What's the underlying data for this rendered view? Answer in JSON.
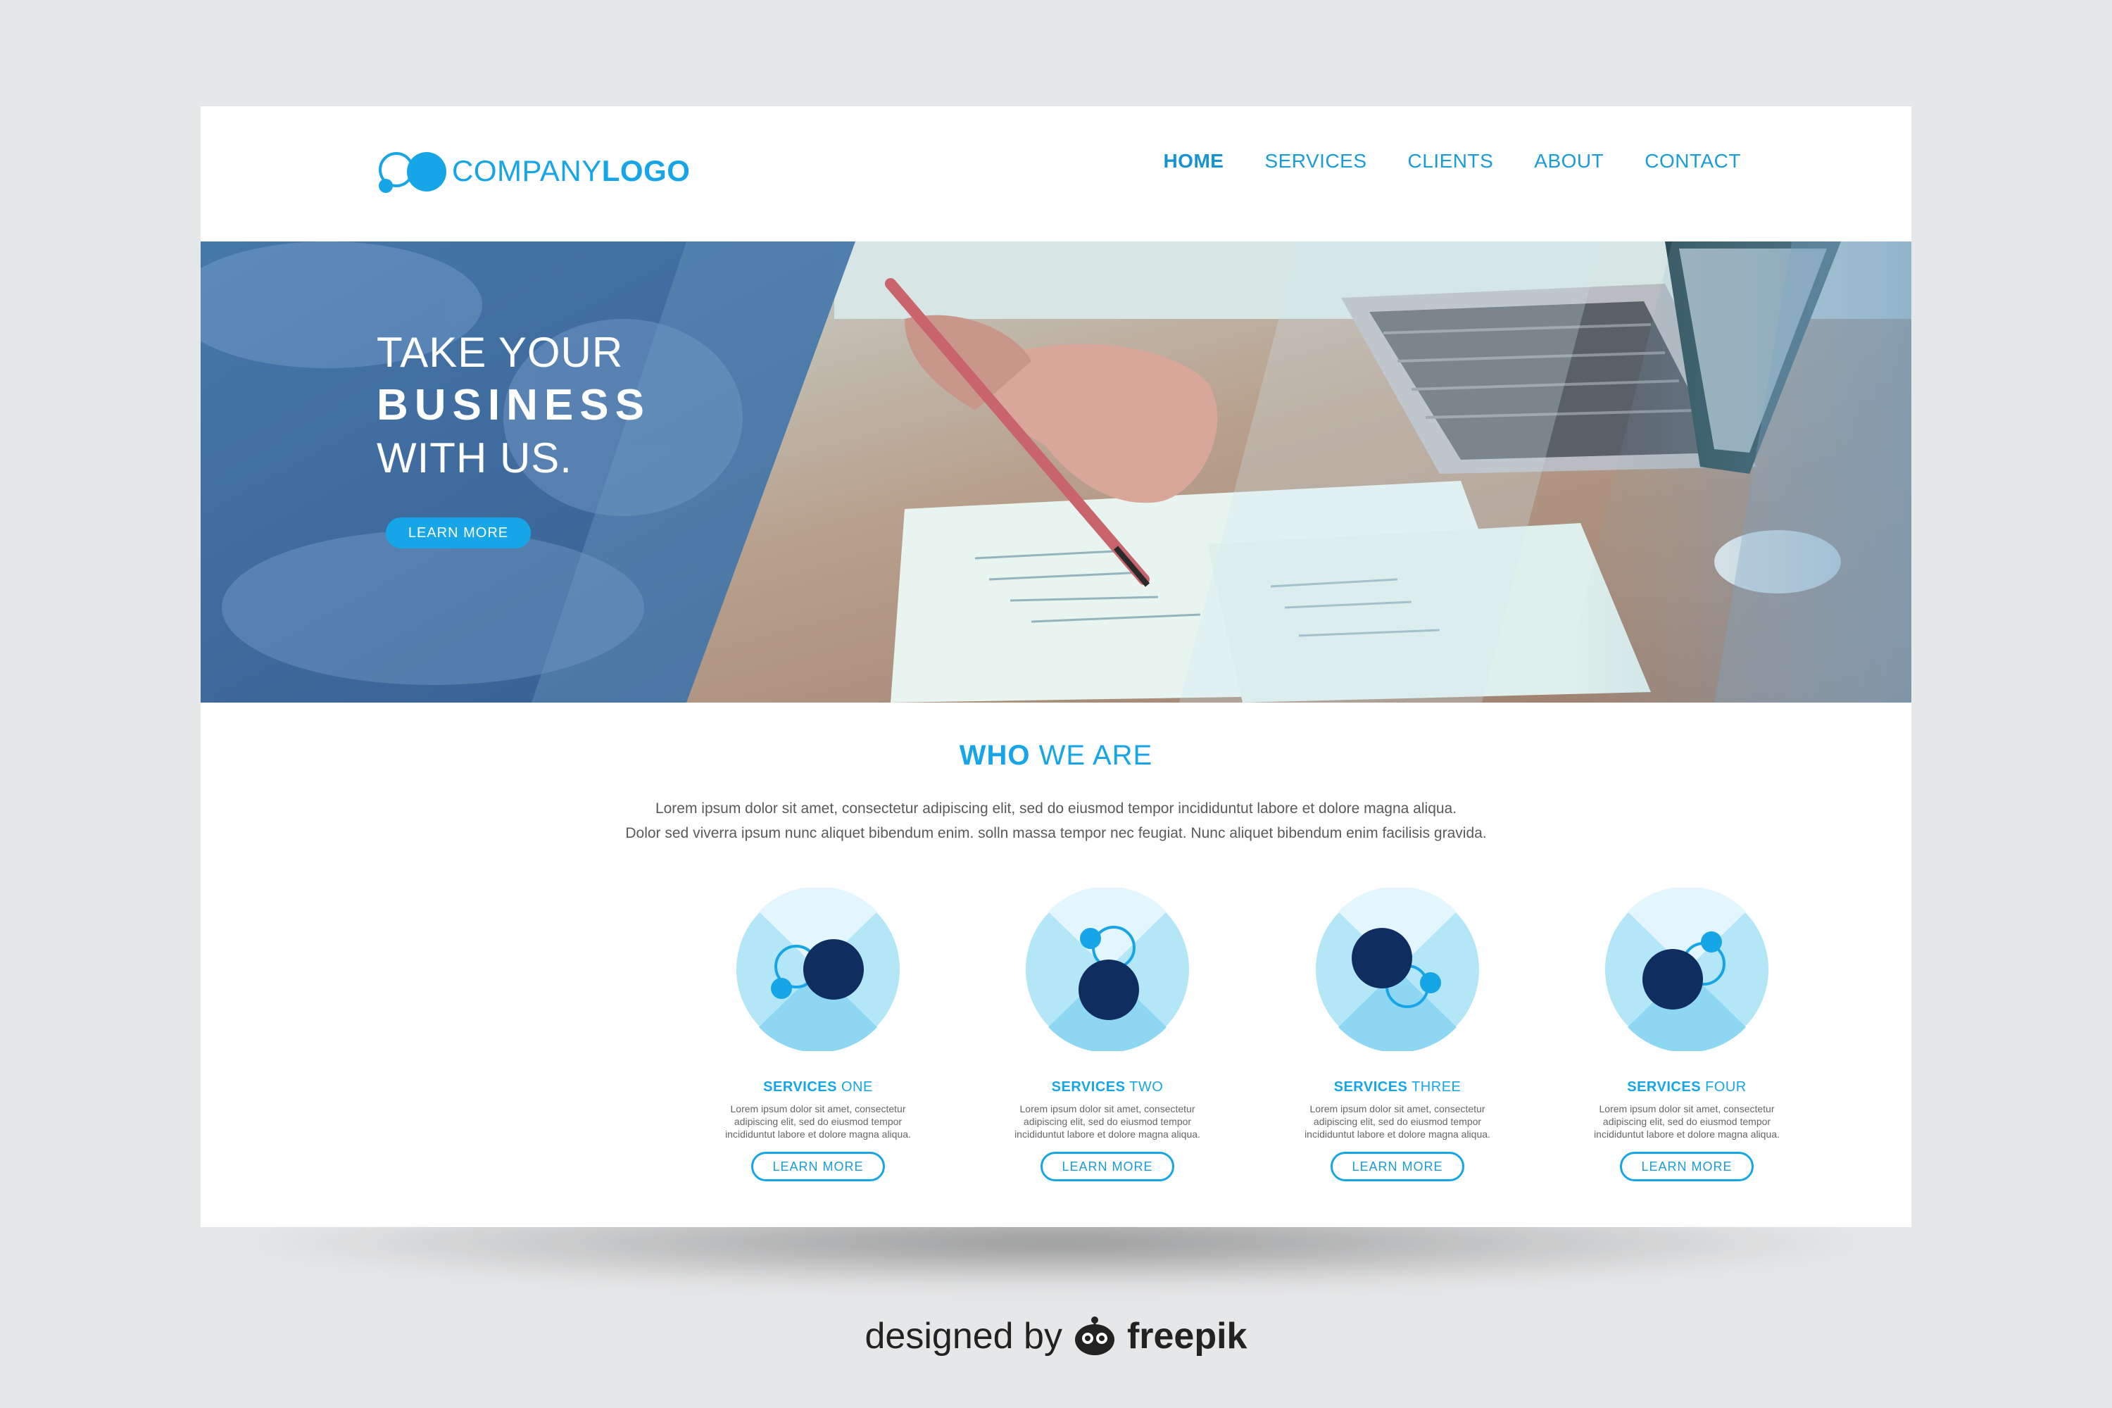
{
  "header": {
    "logo_light": "COMPANY",
    "logo_bold": "LOGO",
    "nav": [
      "HOME",
      "SERVICES",
      "CLIENTS",
      "ABOUT",
      "CONTACT"
    ]
  },
  "hero": {
    "line1": "TAKE YOUR",
    "line2": "BUSINESS",
    "line3": "WITH US.",
    "button": "LEARN MORE"
  },
  "who": {
    "title_bold": "WHO",
    "title_light": " WE ARE",
    "line1": "Lorem ipsum dolor sit amet, consectetur adipiscing elit, sed do eiusmod tempor incididuntut labore et dolore magna aliqua.",
    "line2": "Dolor sed viverra ipsum nunc aliquet bibendum enim. solln massa tempor nec feugiat. Nunc aliquet bibendum enim facilisis gravida."
  },
  "services": [
    {
      "bold": "SERVICES",
      "light": " ONE",
      "desc1": "Lorem ipsum dolor sit amet, consectetur",
      "desc2": "adipiscing elit,  sed do eiusmod tempor",
      "desc3": "incididuntut labore et dolore magna aliqua.",
      "button": "LEARN MORE",
      "icon": "molecule-icon"
    },
    {
      "bold": "SERVICES",
      "light": " TWO",
      "desc1": "Lorem ipsum dolor sit amet, consectetur",
      "desc2": "adipiscing elit,  sed do eiusmod tempor",
      "desc3": "incididuntut labore et dolore magna aliqua.",
      "button": "LEARN MORE",
      "icon": "molecule-icon"
    },
    {
      "bold": "SERVICES",
      "light": " THREE",
      "desc1": "Lorem ipsum dolor sit amet, consectetur",
      "desc2": "adipiscing elit,  sed do eiusmod tempor",
      "desc3": "incididuntut labore et dolore magna aliqua.",
      "button": "LEARN MORE",
      "icon": "molecule-icon"
    },
    {
      "bold": "SERVICES",
      "light": " FOUR",
      "desc1": "Lorem ipsum dolor sit amet, consectetur",
      "desc2": "adipiscing elit,  sed do eiusmod tempor",
      "desc3": "incididuntut labore et dolore magna aliqua.",
      "button": "LEARN MORE",
      "icon": "molecule-icon"
    }
  ],
  "credit": {
    "prefix": "designed by",
    "brand": "freepik"
  },
  "colors": {
    "accent": "#16a6e8",
    "navy": "#0f2d5e",
    "light_blue": "#b3e6f7"
  }
}
